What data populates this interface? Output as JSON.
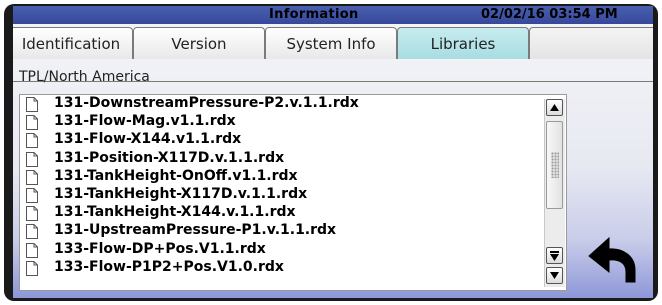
{
  "header": {
    "title": "Information",
    "datetime": "02/02/16 03:54 PM"
  },
  "tabs": [
    {
      "label": "Identification"
    },
    {
      "label": "Version"
    },
    {
      "label": "System Info"
    },
    {
      "label": "Libraries",
      "active": true
    },
    {
      "label": ""
    }
  ],
  "section": {
    "label": "TPL/North America"
  },
  "files": [
    "131-DownstreamPressure-P2.v.1.1.rdx",
    "131-Flow-Mag.v1.1.rdx",
    "131-Flow-X144.v1.1.rdx",
    "131-Position-X117D.v.1.1.rdx",
    "131-TankHeight-OnOff.v1.1.rdx",
    "131-TankHeight-X117D.v.1.1.rdx",
    "131-TankHeight-X144.v.1.1.rdx",
    "131-UpstreamPressure-P1.v.1.1.rdx",
    "133-Flow-DP+Pos.V1.1.rdx",
    "133-Flow-P1P2+Pos.V1.0.rdx"
  ],
  "icons": {
    "file": "file-icon",
    "scroll_up": "arrow-up-icon",
    "scroll_down": "arrow-down-icon",
    "back": "back-arrow-icon"
  },
  "colors": {
    "titlebar": "#3f53a6",
    "active_tab": "#b4e3e7",
    "background_bottom": "#8e97d8"
  }
}
